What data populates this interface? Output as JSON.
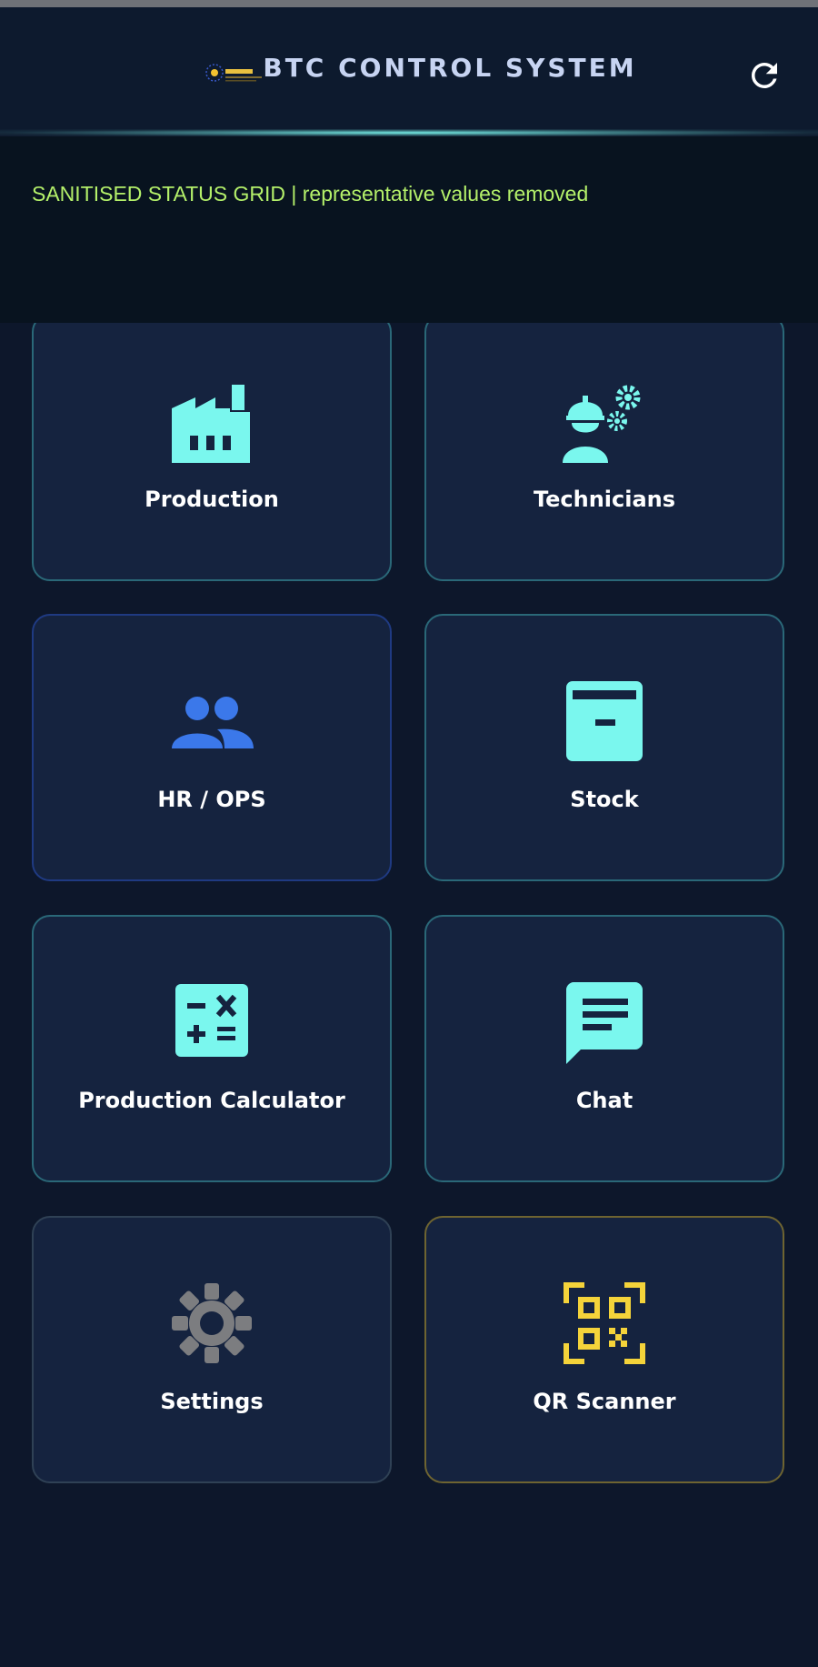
{
  "header": {
    "title": "BTC CONTROL SYSTEM",
    "logo_icon": "company-logo-icon",
    "refresh_icon": "refresh-icon"
  },
  "status": {
    "text": "SANITISED STATUS GRID | representative values removed"
  },
  "colors": {
    "background": "#0d172b",
    "card_background": "#15233f",
    "accent_cyan": "#7af7ee",
    "accent_blue": "#3b78ea",
    "accent_gray": "#7c7d80",
    "accent_yellow": "#f4d33a",
    "status_text": "#b4f06a"
  },
  "tiles": [
    {
      "label": "Production",
      "icon": "factory-icon"
    },
    {
      "label": "Technicians",
      "icon": "technician-gears-icon"
    },
    {
      "label": "HR / OPS",
      "icon": "people-icon"
    },
    {
      "label": "Stock",
      "icon": "archive-box-icon"
    },
    {
      "label": "Production Calculator",
      "icon": "calculator-icon"
    },
    {
      "label": "Chat",
      "icon": "chat-icon"
    },
    {
      "label": "Settings",
      "icon": "gear-icon"
    },
    {
      "label": "QR Scanner",
      "icon": "qr-code-icon"
    }
  ]
}
